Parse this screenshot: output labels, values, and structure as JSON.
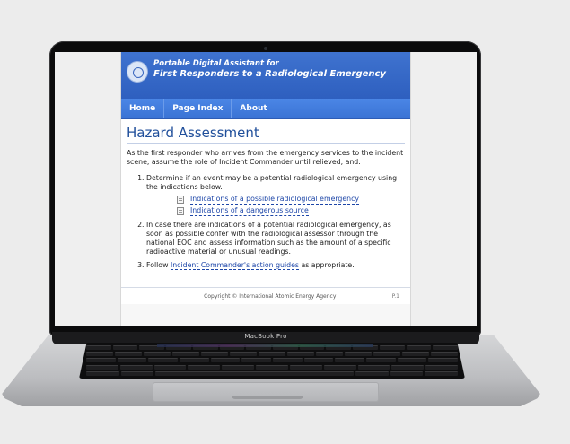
{
  "device": {
    "brand_label": "MacBook Pro"
  },
  "app": {
    "title_line1": "Portable Digital Assistant for",
    "title_line2": "First Responders to a Radiological Emergency",
    "logo_icon": "iaea-logo-icon"
  },
  "nav": {
    "items": [
      {
        "label": "Home"
      },
      {
        "label": "Page Index"
      },
      {
        "label": "About"
      }
    ]
  },
  "main": {
    "heading": "Hazard Assessment",
    "intro": "As the first responder who arrives from the emergency services to the incident scene, assume the role of Incident Commander until relieved, and:",
    "steps": [
      {
        "text": "Determine if an event may be a potential radiological emergency using the indications below."
      },
      {
        "text": "In case there are indications of a potential radiological emergency, as soon as possible confer with the radiological assessor through the national EOC and assess information such as the amount of a specific radioactive material or unusual readings."
      },
      {
        "prefix": "Follow ",
        "link": "Incident Commander's action guides",
        "suffix": " as appropriate."
      }
    ],
    "indication_links": [
      {
        "label": "Indications of a possible radiological emergency"
      },
      {
        "label": "Indications of a dangerous source"
      }
    ],
    "colors": {
      "link": "#1d46a8",
      "heading": "#1f4e9a",
      "header_bg": "#2e5fbf"
    }
  },
  "footer": {
    "copyright": "Copyright © International Atomic Energy Agency",
    "page": "P.1"
  }
}
